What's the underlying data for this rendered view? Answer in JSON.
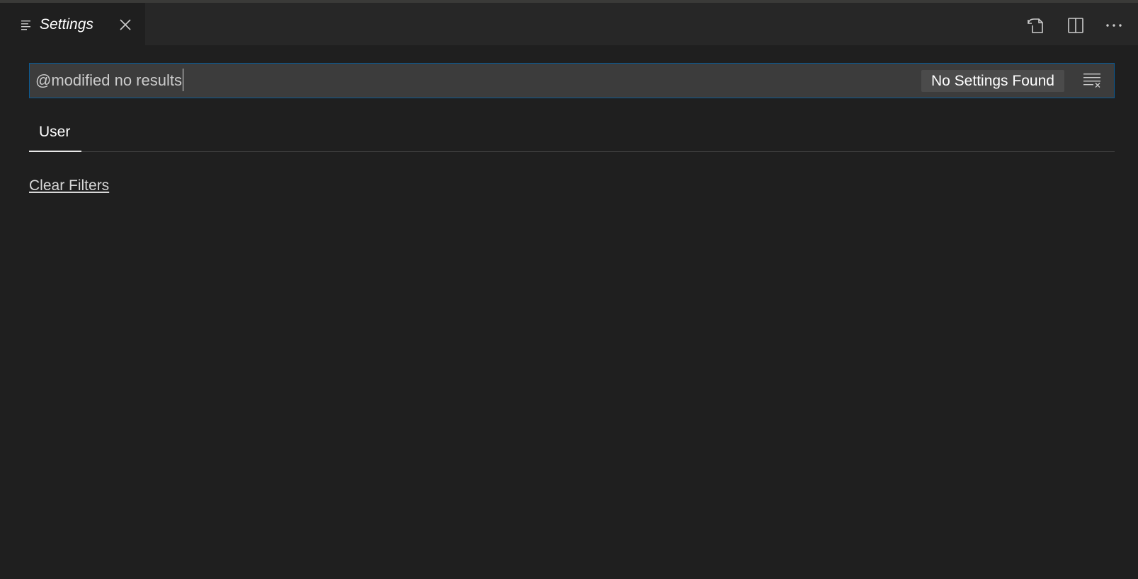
{
  "tab": {
    "title": "Settings",
    "icon": "list-lines-icon",
    "close_icon": "close-icon"
  },
  "toolbar": {
    "actions": [
      {
        "icon": "open-settings-json-icon"
      },
      {
        "icon": "split-editor-icon"
      },
      {
        "icon": "more-actions-icon"
      }
    ]
  },
  "search": {
    "value": "@modified no results",
    "result_count": "No Settings Found",
    "clear_icon": "clear-filter-icon"
  },
  "scope_tabs": [
    {
      "label": "User",
      "active": true
    }
  ],
  "clear_filters_label": "Clear Filters",
  "colors": {
    "background": "#1f1f1f",
    "tabbar": "#272727",
    "input": "#3c3c3c",
    "focus_border": "#0a5a93",
    "badge": "#4b4b4b"
  }
}
